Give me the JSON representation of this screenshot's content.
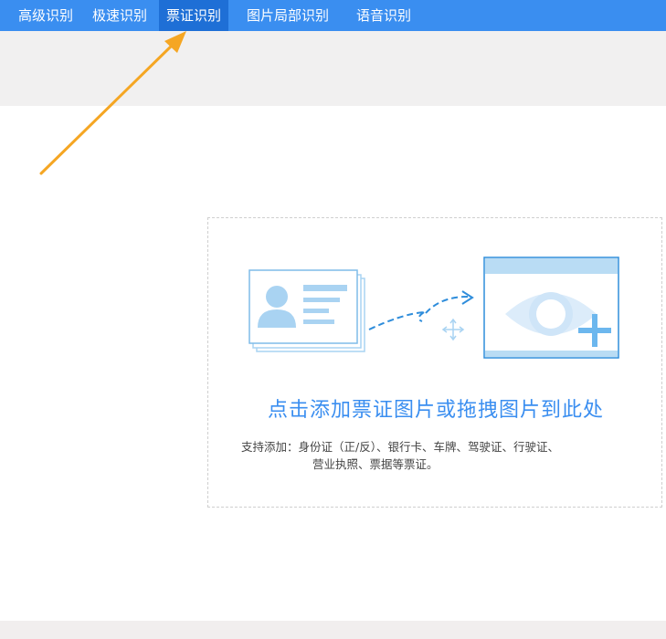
{
  "nav": {
    "tabs": [
      {
        "label": "高级识别"
      },
      {
        "label": "极速识别"
      },
      {
        "label": "票证识别",
        "active": true
      },
      {
        "label": "图片局部识别"
      },
      {
        "label": "语音识别"
      }
    ]
  },
  "upload": {
    "main_text": "点击添加票证图片或拖拽图片到此处",
    "support_line1": "支持添加：身份证（正/反）、银行卡、车牌、驾驶证、行驶证、",
    "support_line2": "营业执照、票据等票证。"
  },
  "colors": {
    "topbar": "#3a8ef0",
    "active_tab": "#1e6fd6",
    "accent_text": "#3a8ef0",
    "arrow": "#f5a623"
  },
  "icons": [
    "id-card-icon",
    "move-icon",
    "eye-icon",
    "plus-icon"
  ]
}
